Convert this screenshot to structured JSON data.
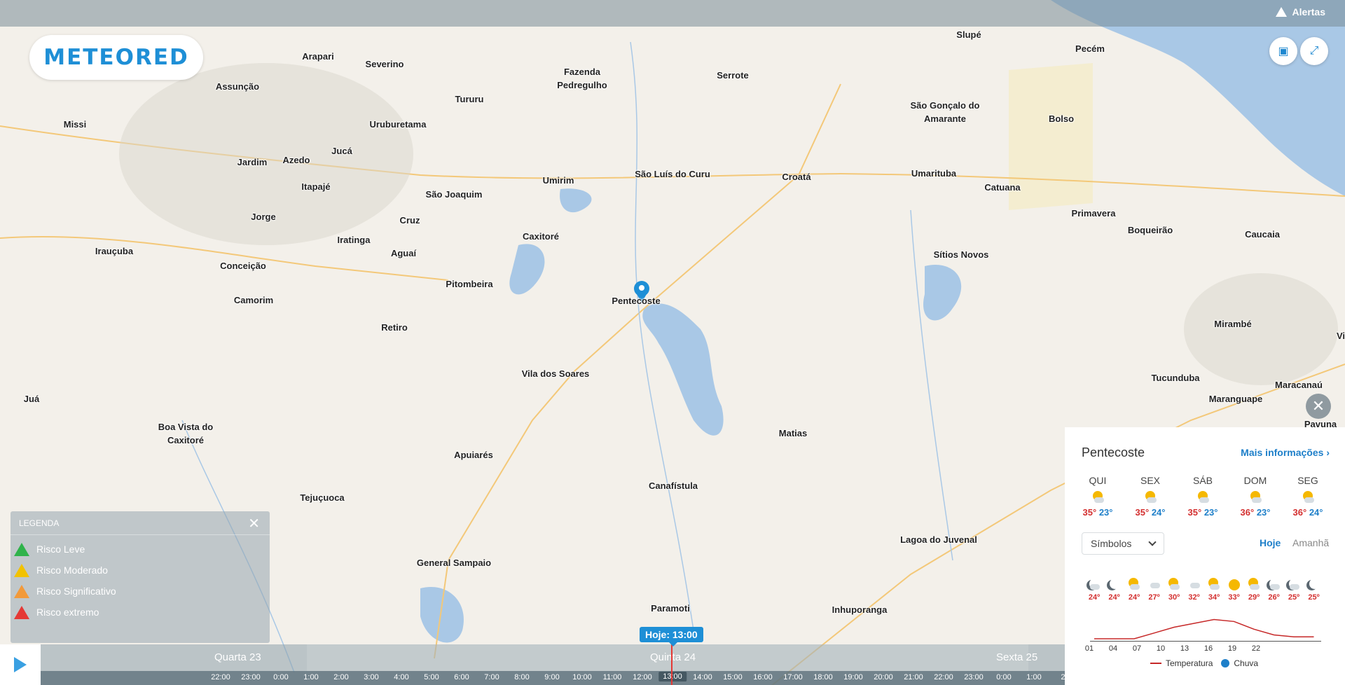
{
  "header": {
    "alerts_label": "Alertas"
  },
  "logo": {
    "text": "METEORED"
  },
  "map": {
    "places": [
      {
        "name": "Arapari"
      },
      {
        "name": "Severino"
      },
      {
        "name": "Assunção"
      },
      {
        "name": "Missi"
      },
      {
        "name": "Tururu"
      },
      {
        "name": "Fazenda\nPedregulho"
      },
      {
        "name": "Serrote"
      },
      {
        "name": "Slupé"
      },
      {
        "name": "Pecém"
      },
      {
        "name": "Uruburetama"
      },
      {
        "name": "São Gonçalo do\nAmarante"
      },
      {
        "name": "Bolso"
      },
      {
        "name": "Jucá"
      },
      {
        "name": "Jardim"
      },
      {
        "name": "Azedo"
      },
      {
        "name": "Itapajé"
      },
      {
        "name": "São Joaquim"
      },
      {
        "name": "Umirim"
      },
      {
        "name": "São Luís do Curu"
      },
      {
        "name": "Croatá"
      },
      {
        "name": "Umarituba"
      },
      {
        "name": "Catuana"
      },
      {
        "name": "Jorge"
      },
      {
        "name": "Cruz"
      },
      {
        "name": "Primavera"
      },
      {
        "name": "Boqueirão"
      },
      {
        "name": "Caucaia"
      },
      {
        "name": "Iratinga"
      },
      {
        "name": "Caxitoré"
      },
      {
        "name": "Irauçuba"
      },
      {
        "name": "Aguaí"
      },
      {
        "name": "Sítios Novos"
      },
      {
        "name": "Conceição"
      },
      {
        "name": "Pitombeira"
      },
      {
        "name": "Pentecoste"
      },
      {
        "name": "Camorim"
      },
      {
        "name": "Retiro"
      },
      {
        "name": "Mirambé"
      },
      {
        "name": "Vila dos Soares"
      },
      {
        "name": "Tucunduba"
      },
      {
        "name": "Maracanaú"
      },
      {
        "name": "Juá"
      },
      {
        "name": "Maranguape"
      },
      {
        "name": "Boa Vista do\nCaxitoré"
      },
      {
        "name": "Matias"
      },
      {
        "name": "Pavuna"
      },
      {
        "name": "Apuiarés"
      },
      {
        "name": "Canafístula"
      },
      {
        "name": "Tejuçuoca"
      },
      {
        "name": "Lagoa do Juvenal"
      },
      {
        "name": "General Sampaio"
      },
      {
        "name": "Paramoti"
      },
      {
        "name": "Inhuporanga"
      },
      {
        "name": "Vi"
      }
    ]
  },
  "legend": {
    "title": "LEGENDA",
    "items": [
      {
        "label": "Risco Leve",
        "color": "#2fb34a"
      },
      {
        "label": "Risco Moderado",
        "color": "#f2c200"
      },
      {
        "label": "Risco Significativo",
        "color": "#f29a3a"
      },
      {
        "label": "Risco extremo",
        "color": "#e53935"
      }
    ]
  },
  "timeline": {
    "now_label": "Hoje: 13:00",
    "days": [
      "Quarta 23",
      "Quinta 24",
      "Sexta 25"
    ],
    "hours": [
      "22:00",
      "23:00",
      "0:00",
      "1:00",
      "2:00",
      "3:00",
      "4:00",
      "5:00",
      "6:00",
      "7:00",
      "8:00",
      "9:00",
      "10:00",
      "11:00",
      "12:00",
      "13:00",
      "14:00",
      "15:00",
      "16:00",
      "17:00",
      "18:00",
      "19:00",
      "20:00",
      "21:00",
      "22:00",
      "23:00",
      "0:00",
      "1:00",
      "2:"
    ],
    "current_hour": "13:00"
  },
  "forecast": {
    "city": "Pentecoste",
    "more_label": "Mais informações",
    "days": [
      {
        "day": "QUI",
        "max": "35°",
        "min": "23°",
        "icon": "sun-cloud-icon"
      },
      {
        "day": "SEX",
        "max": "35°",
        "min": "24°",
        "icon": "sun-cloud-icon"
      },
      {
        "day": "SÁB",
        "max": "35°",
        "min": "23°",
        "icon": "sun-cloud-icon"
      },
      {
        "day": "DOM",
        "max": "36°",
        "min": "23°",
        "icon": "sun-cloud-icon"
      },
      {
        "day": "SEG",
        "max": "36°",
        "min": "24°",
        "icon": "sun-cloud-icon"
      }
    ],
    "symbols_select": "Símbolos",
    "tab_today": "Hoje",
    "tab_tomorrow": "Amanhã",
    "hourly_temps": [
      "24º",
      "24º",
      "24º",
      "27º",
      "30º",
      "32º",
      "34º",
      "33º",
      "29º",
      "26º",
      "25º",
      "25º"
    ],
    "hourly_icons": [
      "moon-cloud-icon",
      "moon-icon",
      "sun-cloud-icon",
      "cloud-icon",
      "sun-cloud-icon",
      "cloud-icon",
      "sun-cloud-icon",
      "sun-icon",
      "sun-cloud-icon",
      "moon-cloud-icon",
      "moon-cloud-icon",
      "moon-icon"
    ],
    "x_ticks": [
      "01",
      "04",
      "07",
      "10",
      "13",
      "16",
      "19",
      "22"
    ],
    "legend_temp": "Temperatura",
    "legend_rain": "Chuva",
    "temp_values": [
      24,
      24,
      24,
      27,
      30,
      32,
      34,
      33,
      29,
      26,
      25,
      25
    ],
    "temp_color": "#c62828",
    "rain_color": "#1e7fc9"
  }
}
